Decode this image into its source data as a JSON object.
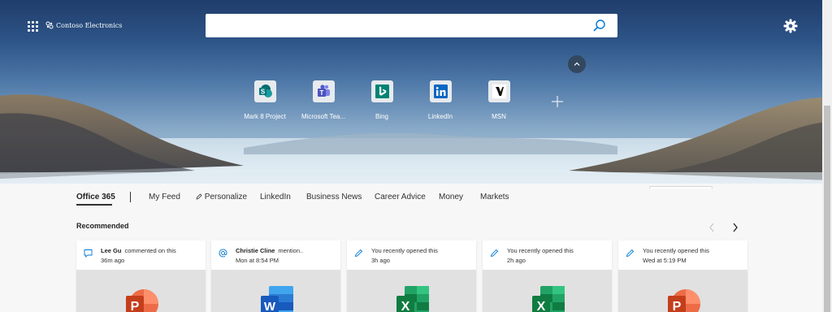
{
  "header": {
    "org_name": "Contoso Electronics",
    "search_placeholder": ""
  },
  "pinned_sites": [
    {
      "label": "Mark 8 Project",
      "icon": "sharepoint-icon"
    },
    {
      "label": "Microsoft Tea...",
      "icon": "teams-icon"
    },
    {
      "label": "Bing",
      "icon": "bing-icon"
    },
    {
      "label": "LinkedIn",
      "icon": "linkedin-icon"
    },
    {
      "label": "MSN",
      "icon": "msn-icon"
    }
  ],
  "nav": {
    "tabs": [
      {
        "label": "Office 365",
        "active": true
      },
      {
        "label": "My Feed"
      },
      {
        "label": "Personalize"
      },
      {
        "label": "LinkedIn"
      },
      {
        "label": "Business News"
      },
      {
        "label": "Career Advice"
      },
      {
        "label": "Money"
      },
      {
        "label": "Markets"
      }
    ]
  },
  "recommended": {
    "title": "Recommended",
    "cards": [
      {
        "person": "Lee Gu",
        "action": "commented on this",
        "time": "36m ago",
        "icon": "comment-icon",
        "app": "powerpoint"
      },
      {
        "person": "Christie Cline",
        "action": "mention..",
        "time": "Mon at 8:54 PM",
        "icon": "mention-icon",
        "app": "word"
      },
      {
        "person": "",
        "action": "You recently opened this",
        "time": "3h ago",
        "icon": "pencil-icon",
        "app": "excel"
      },
      {
        "person": "",
        "action": "You recently opened this",
        "time": "2h ago",
        "icon": "pencil-icon",
        "app": "excel"
      },
      {
        "person": "",
        "action": "You recently opened this",
        "time": "Wed at 5:19 PM",
        "icon": "pencil-icon",
        "app": "powerpoint"
      }
    ]
  },
  "colors": {
    "powerpoint": "#c43e1c",
    "word": "#185abd",
    "excel": "#107c41",
    "accent": "#0078d4"
  }
}
